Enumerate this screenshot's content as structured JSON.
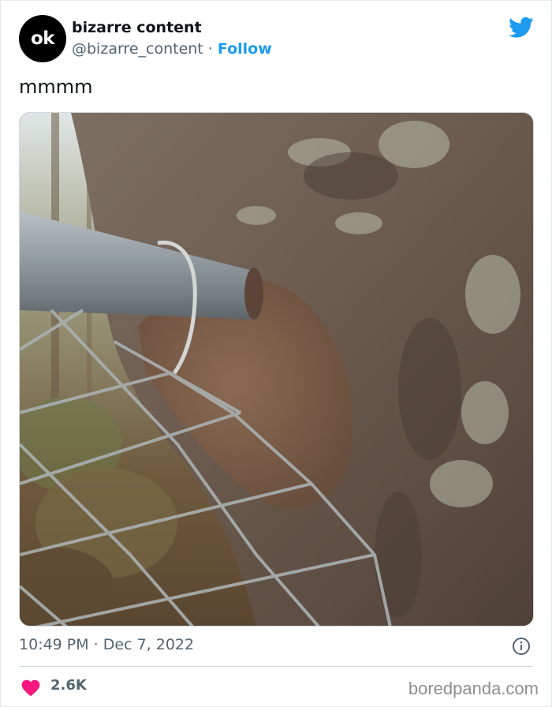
{
  "author": {
    "avatar_text": "ok",
    "display_name": "bizarre content",
    "handle": "@bizarre_content",
    "separator": " · ",
    "follow_label": "Follow"
  },
  "tweet": {
    "text": "mmmm",
    "timestamp": "10:49 PM · Dec 7, 2022",
    "like_count": "2.6K"
  },
  "icons": {
    "platform": "twitter-bird-icon",
    "info": "info-icon",
    "like": "heart-icon"
  },
  "colors": {
    "accent": "#1d9bf0",
    "like": "#f91880",
    "secondary_text": "#536471"
  },
  "watermark": "boredpanda.com"
}
